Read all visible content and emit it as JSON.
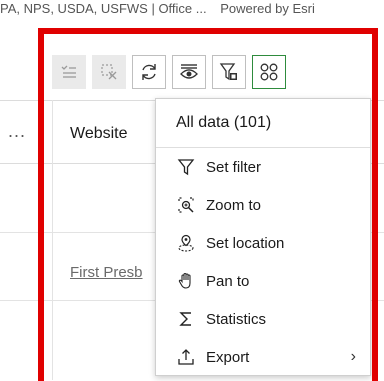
{
  "attribution": {
    "sources": "PA, NPS, USDA, USFWS | Office ...",
    "powered_by": "Powered by Esri"
  },
  "toolbar": {
    "buttons": [
      {
        "icon": "select-all-icon",
        "state": "disabled"
      },
      {
        "icon": "clear-selection-icon",
        "state": "disabled"
      },
      {
        "icon": "refresh-icon",
        "state": "normal"
      },
      {
        "icon": "show-selection-icon",
        "state": "normal"
      },
      {
        "icon": "filter-by-map-extent-icon",
        "state": "normal"
      },
      {
        "icon": "options-grid-icon",
        "state": "active"
      }
    ],
    "accent_color": "#2e8b3d"
  },
  "table": {
    "columns": [
      "...",
      "Website"
    ],
    "cells": {
      "website_link": "First Presb"
    }
  },
  "menu": {
    "header": "All data (101)",
    "items": [
      {
        "label": "Set filter",
        "icon": "filter-icon"
      },
      {
        "label": "Zoom to",
        "icon": "zoom-to-icon"
      },
      {
        "label": "Set location",
        "icon": "set-location-icon"
      },
      {
        "label": "Pan to",
        "icon": "pan-hand-icon"
      },
      {
        "label": "Statistics",
        "icon": "sigma-icon"
      },
      {
        "label": "Export",
        "icon": "export-icon",
        "has_submenu": true
      }
    ],
    "submenu_chevron": "›"
  },
  "colors": {
    "highlight": "#e00000",
    "active_border": "#2e8b3d"
  }
}
